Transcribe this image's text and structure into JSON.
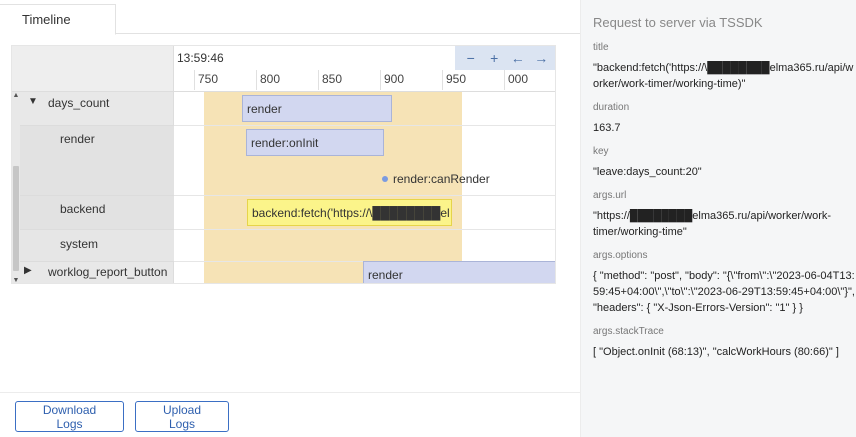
{
  "tabs": [
    {
      "label": "Timeline",
      "active": true
    }
  ],
  "timeline": {
    "start_time": "13:59:46",
    "ticks": [
      "750",
      "800",
      "850",
      "900",
      "950",
      "000"
    ],
    "controls": {
      "zoom_out": "−",
      "zoom_in": "+",
      "back": "←",
      "forward": "→"
    },
    "rows": [
      {
        "label": "days_count",
        "expanded": true
      },
      {
        "label": "render"
      },
      {
        "label": "backend"
      },
      {
        "label": "system"
      },
      {
        "label": "worklog_report_button",
        "expanded": false
      }
    ],
    "bars": {
      "days_count_render": "render",
      "render_oninit": "render:onInit",
      "render_canrender": "render:canRender",
      "backend_fetch": "backend:fetch('https://\\████████el",
      "worklog_render": "render"
    },
    "colors": {
      "highlight": "#f6e3b6",
      "bar": "#d2d7f0",
      "backend_bar": "#fbf48a",
      "accent": "#2e5fae"
    }
  },
  "buttons": {
    "download": "Download Logs",
    "upload": "Upload Logs"
  },
  "details": {
    "title": "Request to server via TSSDK",
    "fields": [
      {
        "label": "title",
        "value": "\"backend:fetch('https://\\████████elma365.ru/api/worker/work-timer/working-time)\""
      },
      {
        "label": "duration",
        "value": "163.7"
      },
      {
        "label": "key",
        "value": "\"leave:days_count:20\""
      },
      {
        "label": "args.url",
        "value": "\"https://████████elma365.ru/api/worker/work-timer/working-time\""
      },
      {
        "label": "args.options",
        "value": "{ \"method\": \"post\", \"body\": \"{\\\"from\\\":\\\"2023-06-04T13:59:45+04:00\\\",\\\"to\\\":\\\"2023-06-29T13:59:45+04:00\\\"}\", \"headers\": { \"X-Json-Errors-Version\": \"1\" } }"
      },
      {
        "label": "args.stackTrace",
        "value": "[ \"Object.onInit (68:13)\", \"calcWorkHours (80:66)\" ]"
      }
    ]
  }
}
